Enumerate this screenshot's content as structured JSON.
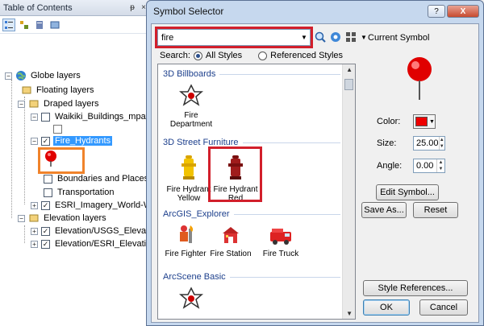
{
  "toc": {
    "title": "Table of Contents",
    "pin_glyph": "ᵽ",
    "close_glyph": "×",
    "layers": {
      "globe": "Globe layers",
      "floating": "Floating layers",
      "draped": "Draped layers",
      "waikiki": "Waikiki_Buildings_mpatc",
      "fire_hydrants": "Fire_Hydrants",
      "boundaries": "Boundaries and Places",
      "transportation": "Transportation",
      "imagery": "ESRI_Imagery_World-W",
      "elevation": "Elevation layers",
      "elev_usgs": "Elevation/USGS_Elevation",
      "elev_esri": "Elevation/ESRI_Elevation"
    }
  },
  "dialog": {
    "title": "Symbol Selector",
    "help_label": "?",
    "close_label": "X",
    "search_value": "fire",
    "search_label": "Search:",
    "all_styles": "All Styles",
    "referenced_styles": "Referenced Styles",
    "groups": {
      "billboards": "3D Billboards",
      "street": "3D Street Furniture",
      "explorer": "ArcGIS_Explorer",
      "arcscene": "ArcScene Basic"
    },
    "symbols": {
      "fire_department": "Fire Department",
      "hydrant_yellow": "Fire Hydrant Yellow",
      "hydrant_red": "Fire Hydrant Red",
      "fire_fighter": "Fire Fighter",
      "fire_station": "Fire Station",
      "fire_truck": "Fire Truck"
    },
    "current_symbol_label": "Current Symbol",
    "color_label": "Color:",
    "size_label": "Size:",
    "size_value": "25.00",
    "angle_label": "Angle:",
    "angle_value": "0.00",
    "edit_symbol": "Edit Symbol...",
    "save_as": "Save As...",
    "reset": "Reset",
    "style_references": "Style References...",
    "ok": "OK",
    "cancel": "Cancel"
  },
  "colors": {
    "symbol_red": "#ee0000",
    "highlight_red": "#d21f2b",
    "highlight_orange": "#f0832b",
    "selection_blue": "#3399ff"
  },
  "icons": [
    "globe-icon",
    "layer-icon",
    "pin-icon",
    "search-icon",
    "fire-hydrant-icon",
    "fire-truck-icon",
    "fire-station-icon",
    "fire-fighter-icon",
    "fire-department-icon"
  ]
}
